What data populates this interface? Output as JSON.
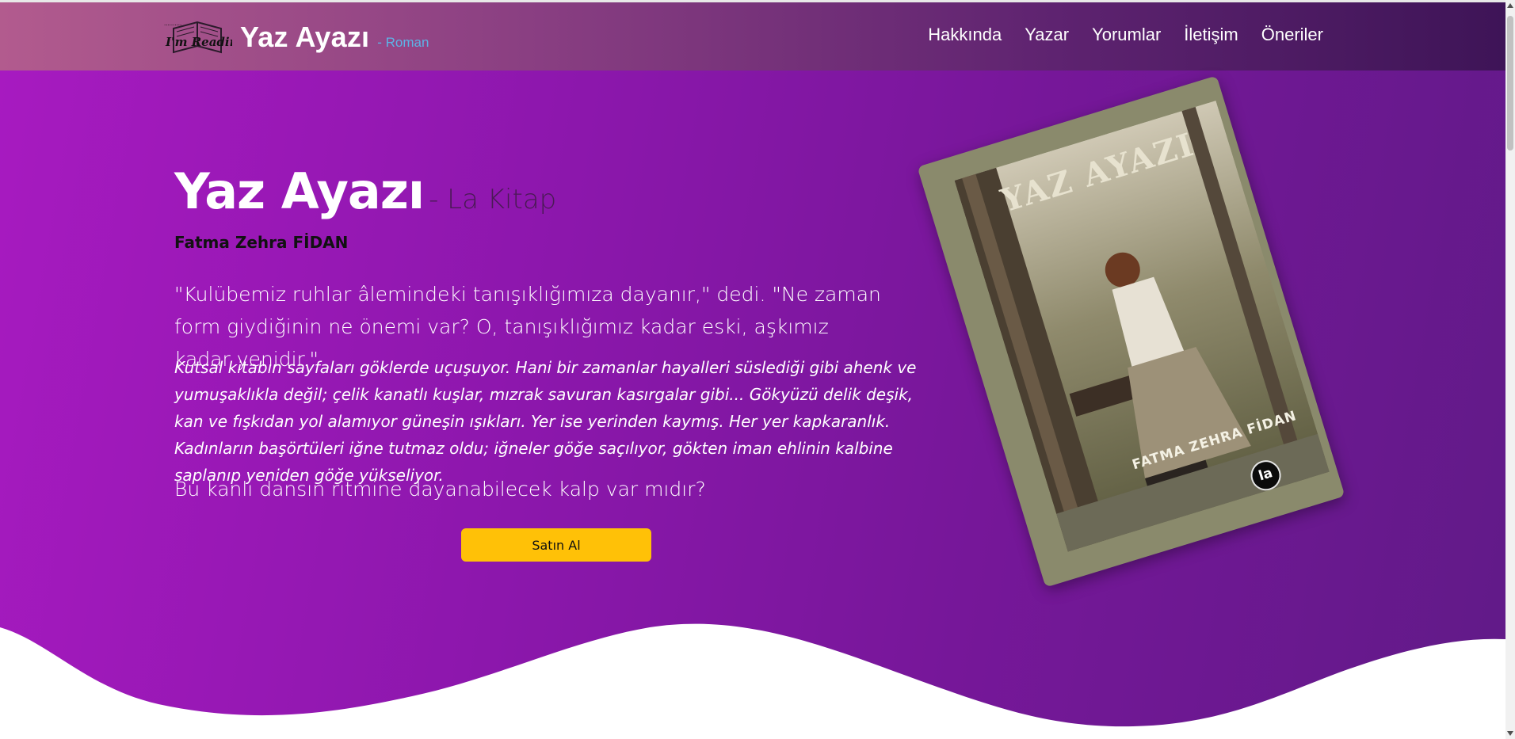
{
  "brand": {
    "logo_text": "I'm Reading",
    "title": "Yaz Ayazı",
    "subtitle": "- Roman"
  },
  "nav": {
    "items": [
      "Hakkında",
      "Yazar",
      "Yorumlar",
      "İletişim",
      "Öneriler"
    ]
  },
  "hero": {
    "title": "Yaz Ayazı",
    "publisher": "- La Kitap",
    "author": "Fatma Zehra FİDAN",
    "quote": "\"Kulübemiz ruhlar âlemindeki tanışıklığımıza dayanır,\" dedi. \"Ne zaman form giydiğinin ne önemi var? O, tanışıklığımız kadar eski, aşkımız kadar yenidir.\"",
    "description": "Kutsal kitabın sayfaları göklerde uçuşuyor. Hani bir zamanlar hayalleri süslediği gibi ahenk ve yumuşaklıkla değil; çelik kanatlı kuşlar, mızrak savuran kasırgalar gibi... Gökyüzü delik deşik, kan ve fışkıdan yol alamıyor güneşin ışıkları. Yer ise yerinden kaymış. Her yer kapkaranlık. Kadınların başörtüleri iğne tutmaz oldu; iğneler göğe saçılıyor, gökten iman ehlinin kalbine saplanıp yeniden göğe yükseliyor.",
    "question": "Bu kanlı dansın ritmine dayanabilecek kalp var mıdır?",
    "buy_label": "Satın Al"
  },
  "cover": {
    "title": "YAZ AYAZI",
    "author": "FATMA ZEHRA FİDAN",
    "publisher_badge": "la"
  },
  "colors": {
    "accent_button": "#ffc107",
    "brand_subtitle": "#5db3e6",
    "hero_gradient_start": "#a71ac0",
    "hero_gradient_end": "#611a88"
  }
}
